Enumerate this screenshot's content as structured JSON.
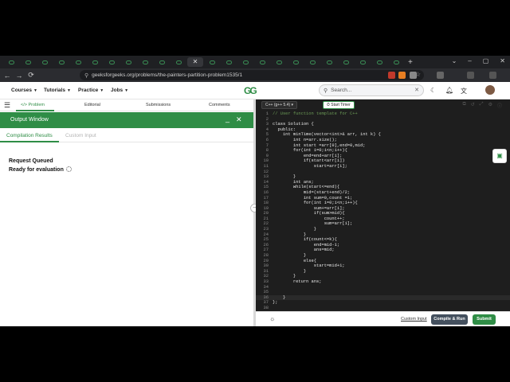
{
  "browser": {
    "tab_count": 24,
    "active_tab_index": 11,
    "new_tab_label": "+",
    "window_controls": [
      "⌄",
      "–",
      "▢",
      "✕"
    ],
    "url": "geeksforgeeks.org/problems/the-painters-partition-problem1535/1",
    "brand_color": "#2f8d46"
  },
  "site": {
    "menu": [
      "Courses",
      "Tutorials",
      "Practice",
      "Jobs"
    ],
    "logo": "GG",
    "search_placeholder": "Search..."
  },
  "problem_tabs": [
    "</> Problem",
    "Editorial",
    "Submissions",
    "Comments"
  ],
  "output": {
    "title": "Output Window",
    "tabs": [
      "Compilation Results",
      "Custom Input"
    ],
    "lines": [
      "Request Queued",
      "Ready for evaluation"
    ]
  },
  "editor": {
    "language": "C++ (g++ 5.4)",
    "timer_label": "Start Timer",
    "code": [
      "// User function template for C++",
      "",
      "class Solution {",
      "  public:",
      "    int minTime(vector<int>& arr, int k) {",
      "        int n=arr.size();",
      "        int start =arr[0],end=0,mid;",
      "        for(int i=0;i<n;i++){",
      "            end=end+arr[i];",
      "            if(start<arr[i])",
      "                start=arr[i];",
      "",
      "        }",
      "        int ans;",
      "        while(start<=end){",
      "            mid=(start+end)/2;",
      "            int sum=0,count =1;",
      "            for(int i=0;i<n;i++){",
      "                sum+=arr[i];",
      "                if(sum>mid){",
      "                    count++;",
      "                    sum=arr[i];",
      "                }",
      "            }",
      "            if(count<=k){",
      "                end=mid-1;",
      "                ans=mid;",
      "            }",
      "            else{",
      "                start=mid+1;",
      "            }",
      "        }",
      "        return ans;",
      "",
      "",
      "    }",
      "};"
    ],
    "line_numbers": [
      "1",
      "2",
      "3",
      "4",
      "5",
      "6",
      "7",
      "8",
      "9",
      "10",
      "11",
      "12",
      "13",
      "14",
      "15",
      "16",
      "17",
      "18",
      "19",
      "20",
      "21",
      "22",
      "23",
      "24",
      "25",
      "26",
      "27",
      "28",
      "29",
      "30",
      "31",
      "32",
      "33",
      "34",
      "35",
      "36",
      "37",
      "38"
    ],
    "current_line": 36,
    "custom_input_label": "Custom Input",
    "compile_label": "Compile & Run",
    "submit_label": "Submit"
  }
}
